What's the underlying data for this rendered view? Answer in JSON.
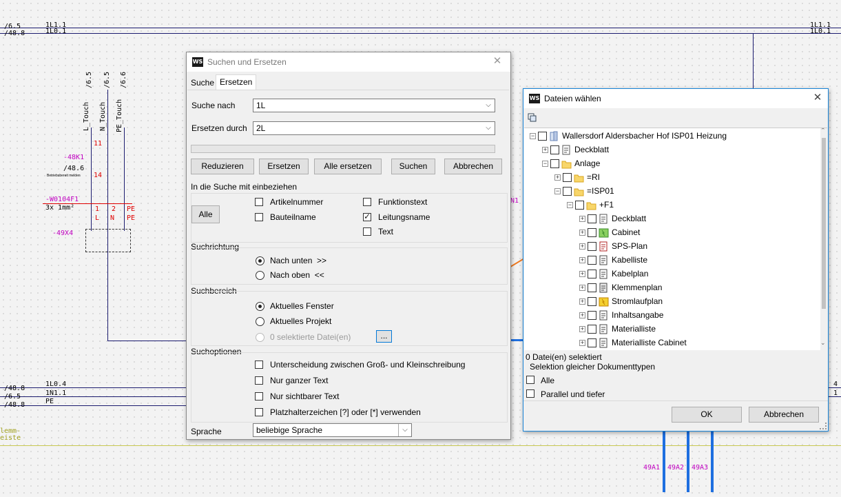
{
  "cad": {
    "top_left_refs": [
      "/6.5",
      "/48.8"
    ],
    "top_left_buses": [
      "1L1.1",
      "1L0.1"
    ],
    "top_right_buses": [
      "1L1.1",
      "1L0.1"
    ],
    "vertical_refs": [
      "/6.5",
      "/6.5",
      "/6.6"
    ],
    "vertical_labels": [
      "L_Touch",
      "N_Touch",
      "PE_Touch"
    ],
    "terminal_nums": [
      "11",
      "14"
    ],
    "device_ref": "-48K1",
    "device_sub": "/48.6",
    "device_note": "Betriebsbereit melden",
    "cable_name": "-W0104F1",
    "cable_spec": "3x 1mm²",
    "cable_cores": [
      "1",
      "2",
      "PE"
    ],
    "cable_cores2": [
      "L",
      "N",
      "PE"
    ],
    "socket_ref": "-49X4",
    "mid_label": "N1",
    "bottom_left_refs": [
      "/48.8",
      "/6.5",
      "/48.8"
    ],
    "bottom_left_buses": [
      "1L0.4",
      "1N1.1",
      "PE"
    ],
    "bottom_right_refs": [
      "4",
      "1"
    ],
    "klemm_labels": [
      "lemm-",
      "eiste"
    ],
    "bottom_device_refs": [
      "49A1",
      "49A2",
      "49A3"
    ]
  },
  "search_dialog": {
    "logo": "WS",
    "title": "Suchen und Ersetzen",
    "tabs": [
      "Suche",
      "Ersetzen"
    ],
    "search_label": "Suche nach",
    "search_value": "1L",
    "replace_label": "Ersetzen durch",
    "replace_value": "2L",
    "buttons": [
      "Reduzieren",
      "Ersetzen",
      "Alle ersetzen",
      "Suchen",
      "Abbrechen"
    ],
    "include_label": "In die Suche mit einbeziehen",
    "alle_button": "Alle",
    "include_options": [
      {
        "label": "Artikelnummer",
        "checked": false
      },
      {
        "label": "Bauteilname",
        "checked": false
      },
      {
        "label": "Funktionstext",
        "checked": false
      },
      {
        "label": "Leitungsname",
        "checked": true
      },
      {
        "label": "Text",
        "checked": false
      }
    ],
    "direction_label": "Suchrichtung",
    "direction_down": "Nach unten  >>",
    "direction_up": "Nach oben  <<",
    "area_label": "Suchbereich",
    "area_window": "Aktuelles Fenster",
    "area_project": "Aktuelles Projekt",
    "area_files": "0 selektierte Datei(en)",
    "browse_button": "...",
    "options_label": "Suchoptionen",
    "options": [
      "Unterscheidung zwischen Groß- und Kleinschreibung",
      "Nur ganzer Text",
      "Nur sichtbarer Text",
      "Platzhalterzeichen [?] oder [*] verwenden"
    ],
    "language_label": "Sprache",
    "language_value": "beliebige Sprache",
    "close_glyph": "✕"
  },
  "files_dialog": {
    "logo": "WS",
    "title": "Dateien wählen",
    "close_glyph": "✕",
    "tree": [
      {
        "label": "Wallersdorf Aldersbacher Hof ISP01 Heizung",
        "level": 0,
        "expander": "−",
        "icon": "project-icon"
      },
      {
        "label": "Deckblatt",
        "level": 1,
        "expander": "+",
        "icon": "document-icon"
      },
      {
        "label": "Anlage",
        "level": 1,
        "expander": "−",
        "icon": "folder-icon"
      },
      {
        "label": "=RI",
        "level": 2,
        "expander": "+",
        "icon": "folder-icon"
      },
      {
        "label": "=ISP01",
        "level": 2,
        "expander": "−",
        "icon": "folder-icon"
      },
      {
        "label": "+F1",
        "level": 3,
        "expander": "−",
        "icon": "folder-icon"
      },
      {
        "label": "Deckblatt",
        "level": 4,
        "expander": "+",
        "icon": "document-icon"
      },
      {
        "label": "Cabinet",
        "level": 4,
        "expander": "+",
        "icon": "cabinet-icon"
      },
      {
        "label": "SPS-Plan",
        "level": 4,
        "expander": "+",
        "icon": "plc-icon"
      },
      {
        "label": "Kabelliste",
        "level": 4,
        "expander": "+",
        "icon": "cable-list-icon"
      },
      {
        "label": "Kabelplan",
        "level": 4,
        "expander": "+",
        "icon": "cable-plan-icon"
      },
      {
        "label": "Klemmenplan",
        "level": 4,
        "expander": "+",
        "icon": "terminal-plan-icon"
      },
      {
        "label": "Stromlaufplan",
        "level": 4,
        "expander": "+",
        "icon": "schematic-icon"
      },
      {
        "label": "Inhaltsangabe",
        "level": 4,
        "expander": "+",
        "icon": "contents-icon"
      },
      {
        "label": "Materialliste",
        "level": 4,
        "expander": "+",
        "icon": "material-list-icon"
      },
      {
        "label": "Materialliste Cabinet",
        "level": 4,
        "expander": "+",
        "icon": "material-list-icon"
      }
    ],
    "status": "0 Datei(en) selektiert",
    "same_types_label": "Selektion gleicher Dokumenttypen",
    "check_all": "Alle",
    "check_parallel": "Parallel und tiefer",
    "ok_button": "OK",
    "cancel_button": "Abbrechen"
  },
  "colors": {
    "bus": "#1a1a6e",
    "cad_magenta": "#c000c0",
    "cad_red": "#e00000",
    "blue_wire": "#1e6fe0",
    "arrow": "#f07a20",
    "focus": "#0078d7"
  }
}
